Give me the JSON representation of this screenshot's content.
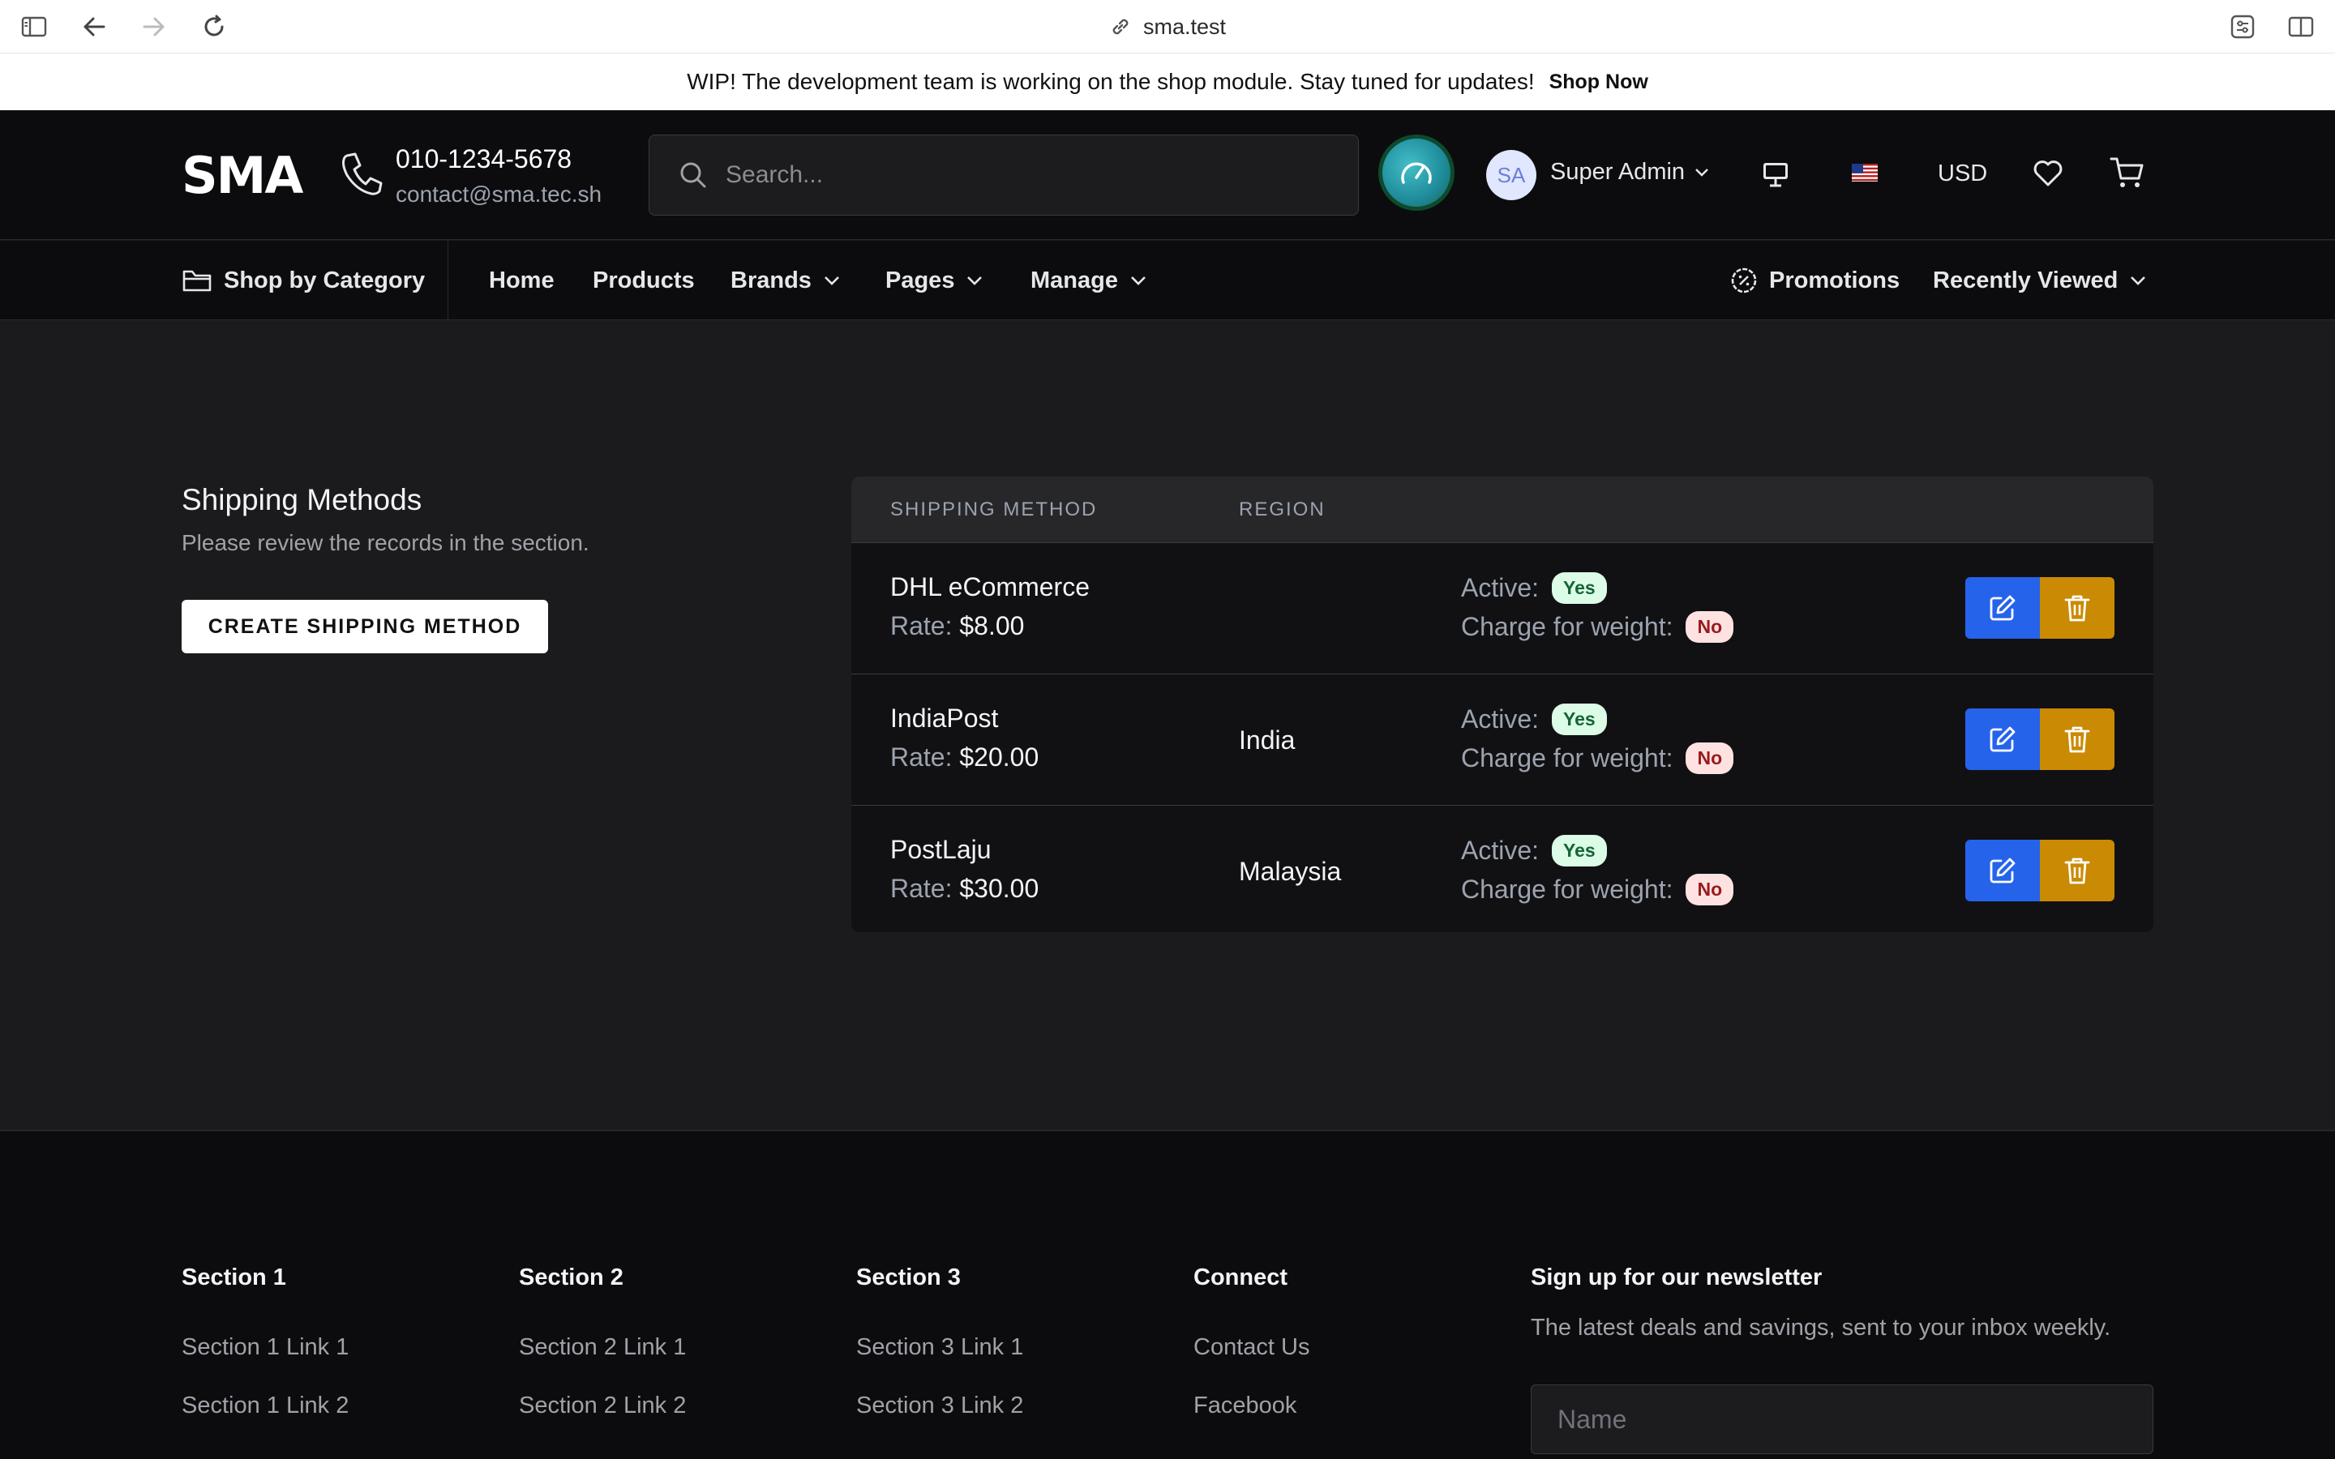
{
  "browser": {
    "url": "sma.test"
  },
  "banner": {
    "text": "WIP! The development team is working on the shop module. Stay tuned for updates!",
    "link": "Shop Now"
  },
  "header": {
    "logo": "SMA",
    "phone": "010-1234-5678",
    "email": "contact@sma.tec.sh",
    "search_placeholder": "Search...",
    "avatar_initials": "SA",
    "user_name": "Super Admin",
    "currency": "USD"
  },
  "nav": {
    "category": "Shop by Category",
    "items": [
      "Home",
      "Products",
      "Brands",
      "Pages",
      "Manage"
    ],
    "promotions": "Promotions",
    "recently_viewed": "Recently Viewed"
  },
  "page": {
    "title": "Shipping Methods",
    "subtitle": "Please review the records in the section.",
    "create_button": "CREATE SHIPPING METHOD"
  },
  "table": {
    "columns": [
      "SHIPPING METHOD",
      "REGION"
    ],
    "rate_label": "Rate:",
    "active_label": "Active:",
    "weight_label": "Charge for weight:",
    "rows": [
      {
        "name": "DHL eCommerce",
        "rate": "$8.00",
        "region": "",
        "active": "Yes",
        "weight": "No"
      },
      {
        "name": "IndiaPost",
        "rate": "$20.00",
        "region": "India",
        "active": "Yes",
        "weight": "No"
      },
      {
        "name": "PostLaju",
        "rate": "$30.00",
        "region": "Malaysia",
        "active": "Yes",
        "weight": "No"
      }
    ]
  },
  "footer": {
    "sections": [
      {
        "title": "Section 1",
        "links": [
          "Section 1 Link 1",
          "Section 1 Link 2"
        ]
      },
      {
        "title": "Section 2",
        "links": [
          "Section 2 Link 1",
          "Section 2 Link 2"
        ]
      },
      {
        "title": "Section 3",
        "links": [
          "Section 3 Link 1",
          "Section 3 Link 2"
        ]
      },
      {
        "title": "Connect",
        "links": [
          "Contact Us",
          "Facebook"
        ]
      }
    ],
    "newsletter_title": "Sign up for our newsletter",
    "newsletter_desc": "The latest deals and savings, sent to your inbox weekly.",
    "name_placeholder": "Name"
  },
  "colors": {
    "edit": "#2563eb",
    "delete": "#ca8a04",
    "yes_badge": "#dcfce7",
    "no_badge": "#fee2e2"
  }
}
